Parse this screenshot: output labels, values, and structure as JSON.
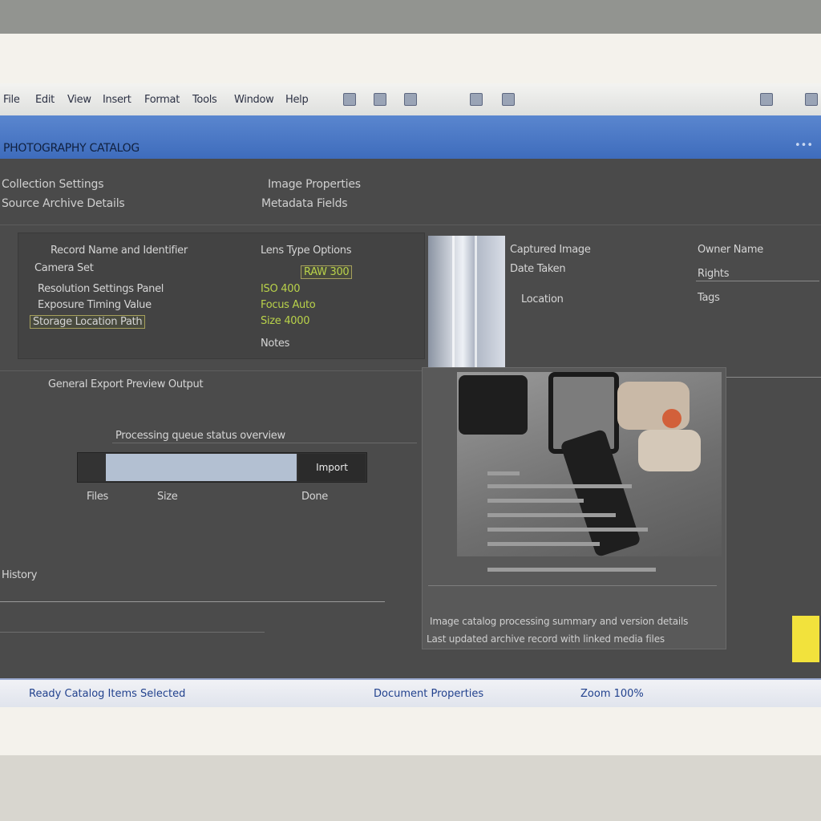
{
  "menu": {
    "items": [
      "File",
      "Edit",
      "View",
      "Insert",
      "Format",
      "Tools",
      "Window",
      "Help"
    ]
  },
  "toolbar": {
    "icons": [
      "folder-icon",
      "save-icon",
      "print-icon",
      "search-icon",
      "settings-icon"
    ]
  },
  "title_bar": {
    "title": "PHOTOGRAPHY CATALOG"
  },
  "header": {
    "row1_left": "Collection Settings",
    "row1_right": "Image Properties",
    "row2_left": "Source Archive Details",
    "row2_right": "Metadata Fields"
  },
  "details": {
    "line1": "Record Name and Identifier",
    "line2": "Camera Set",
    "line3": "Resolution Settings Panel",
    "line4": "Exposure Timing Value",
    "line5": "Storage Location Path",
    "right_line1": "Lens Type Options",
    "right_chip": "RAW 300",
    "right_line2": "ISO 400",
    "right_line3": "Focus Auto",
    "right_line4": "Size 4000",
    "right_line5": "Notes"
  },
  "info": {
    "line1": "Captured Image",
    "line2": "Date Taken",
    "line3": "Location",
    "right_line1": "Owner Name",
    "right_line2": "Rights",
    "right_line3": "Tags"
  },
  "lower": {
    "tabs_line": "General  Export  Preview  Output",
    "sub_line": "Processing queue status overview",
    "progress_button": "Import",
    "progress_fraction": 0.66,
    "meta_left": "Files",
    "meta_mid": "Size",
    "meta_right": "Done",
    "section_label": "History"
  },
  "footer": {
    "row1": "Image catalog processing summary and version details",
    "row2": "Last updated archive record with linked media files"
  },
  "status_bar": {
    "left": "Ready  Catalog  Items  Selected",
    "mid": "Document Properties",
    "right": "Zoom  100%"
  }
}
